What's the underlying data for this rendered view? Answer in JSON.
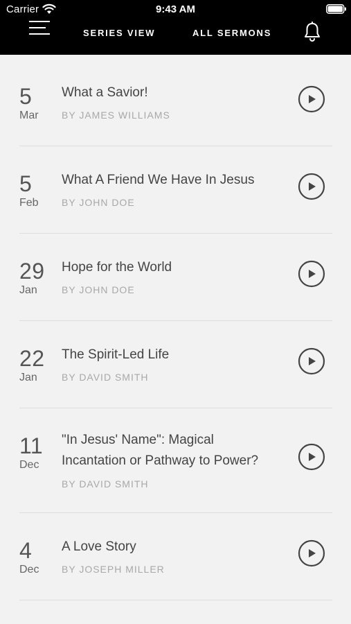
{
  "status_bar": {
    "carrier": "Carrier",
    "time": "9:43 AM",
    "icons": [
      "wifi-icon",
      "battery-icon"
    ]
  },
  "nav": {
    "menu_icon": "hamburger-menu-icon",
    "tabs": [
      {
        "label": "SERIES VIEW"
      },
      {
        "label": "ALL SERMONS"
      }
    ],
    "notification_icon": "bell-icon"
  },
  "sermons": [
    {
      "day": "5",
      "month": "Mar",
      "title_lines": [
        "What a Savior!"
      ],
      "speaker": "BY JAMES WILLIAMS"
    },
    {
      "day": "5",
      "month": "Feb",
      "title_lines": [
        "What A Friend We Have In Jesus"
      ],
      "speaker": "BY JOHN DOE"
    },
    {
      "day": "29",
      "month": "Jan",
      "title_lines": [
        "Hope for the World"
      ],
      "speaker": "BY JOHN DOE"
    },
    {
      "day": "22",
      "month": "Jan",
      "title_lines": [
        "The Spirit-Led Life"
      ],
      "speaker": "BY DAVID SMITH"
    },
    {
      "day": "11",
      "month": "Dec",
      "title_lines": [
        "\"In Jesus' Name\": Magical",
        "Incantation or Pathway to Power?"
      ],
      "speaker": "BY DAVID SMITH"
    },
    {
      "day": "4",
      "month": "Dec",
      "title_lines": [
        "A Love Story"
      ],
      "speaker": "BY JOSEPH MILLER"
    }
  ],
  "colors": {
    "header_bg": "#000000",
    "list_bg": "#f2f2f2",
    "text": "#444444",
    "speaker_text": "#a8a8a8",
    "divider": "#dedede"
  }
}
